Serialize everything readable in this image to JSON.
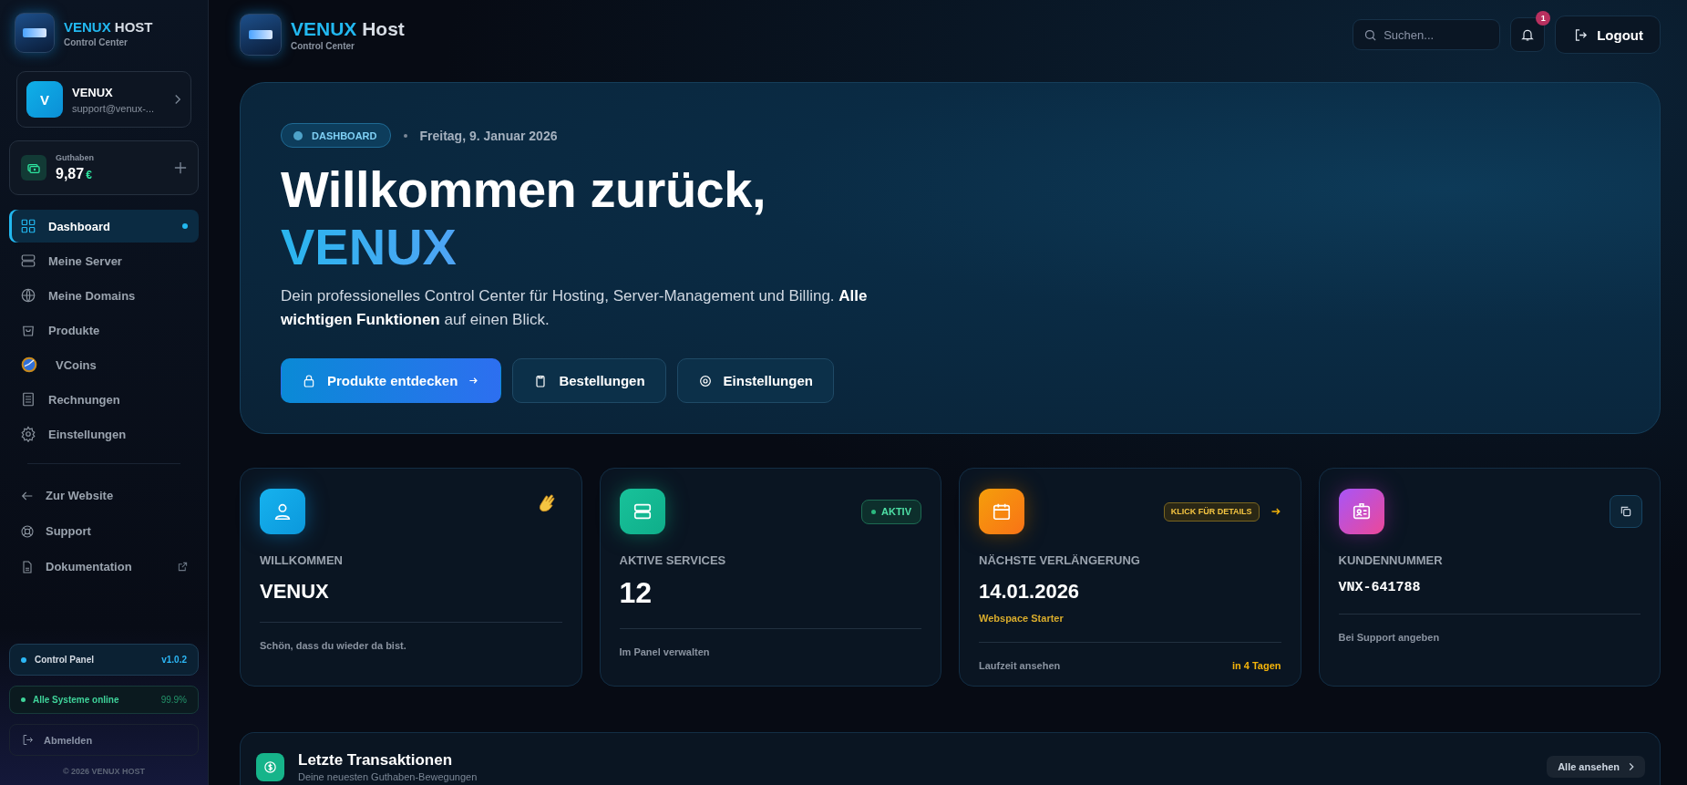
{
  "sidebar": {
    "brand": {
      "name_accent": "VENUX",
      "name_rest": "HOST",
      "subtitle": "Control Center"
    },
    "user": {
      "initial": "V",
      "name": "VENUX",
      "email": "support@venux-..."
    },
    "balance": {
      "label": "Guthaben",
      "amount": "9,87",
      "currency": "€"
    },
    "nav": [
      {
        "kind": "grid",
        "label": "Dashboard",
        "selected": true
      },
      {
        "kind": "server",
        "label": "Meine Server",
        "selected": false
      },
      {
        "kind": "globe",
        "label": "Meine Domains",
        "selected": false
      },
      {
        "kind": "bag",
        "label": "Produkte",
        "selected": false
      },
      {
        "kind": "coin",
        "label": "VCoins",
        "selected": false
      },
      {
        "kind": "receipt",
        "label": "Rechnungen",
        "selected": false
      },
      {
        "kind": "gear",
        "label": "Einstellungen",
        "selected": false
      }
    ],
    "links": [
      {
        "kind": "back",
        "label": "Zur Website",
        "external": false
      },
      {
        "kind": "support",
        "label": "Support",
        "external": false
      },
      {
        "kind": "doc",
        "label": "Dokumentation",
        "external": true
      }
    ],
    "version": {
      "label": "Control Panel",
      "value": "v1.0.2"
    },
    "status": {
      "label": "Alle Systeme online",
      "value": "99.9%"
    },
    "logout": "Abmelden",
    "copyright": "© 2026 VENUX HOST"
  },
  "header": {
    "brand": {
      "name_accent": "VENUX",
      "name_rest": "Host",
      "subtitle": "Control Center"
    },
    "search": {
      "placeholder": "Suchen..."
    },
    "notifications": "1",
    "logout": "Logout"
  },
  "hero": {
    "badge": "DASHBOARD",
    "date": "Freitag, 9. Januar 2026",
    "title": "Willkommen zurück,",
    "name": "VENUX",
    "text": "Dein professionelles Control Center für Hosting, Server-Management und Billing. **Alle wichtigen Funktionen** auf einen Blick.",
    "buttons": [
      {
        "kind": "shop",
        "label": "Produkte entdecken",
        "primary": true
      },
      {
        "kind": "orders",
        "label": "Bestellungen",
        "primary": false
      },
      {
        "kind": "settings",
        "label": "Einstellungen",
        "primary": false
      }
    ]
  },
  "cards": [
    {
      "kind": "welcome",
      "label": "WILLKOMMEN",
      "value": "VENUX",
      "footer": "Schön, dass du wieder da bist."
    },
    {
      "kind": "services",
      "badge": "AKTIV",
      "label": "AKTIVE SERVICES",
      "value": "12",
      "footer": "Im Panel verwalten"
    },
    {
      "kind": "renewal",
      "badge": "KLICK FÜR DETAILS",
      "label": "NÄCHSTE VERLÄNGERUNG",
      "value": "14.01.2026",
      "subtitle": "Webspace Starter",
      "footer": "Laufzeit ansehen",
      "footer_right": "in 4 Tagen"
    },
    {
      "kind": "customer",
      "label": "KUNDENNUMMER",
      "value": "VNX-641788",
      "mono": true,
      "footer": "Bei Support angeben"
    }
  ],
  "transactions": {
    "title": "Letzte Transaktionen",
    "subtitle": "Deine neuesten Guthaben-Bewegungen",
    "button": "Alle ansehen"
  }
}
